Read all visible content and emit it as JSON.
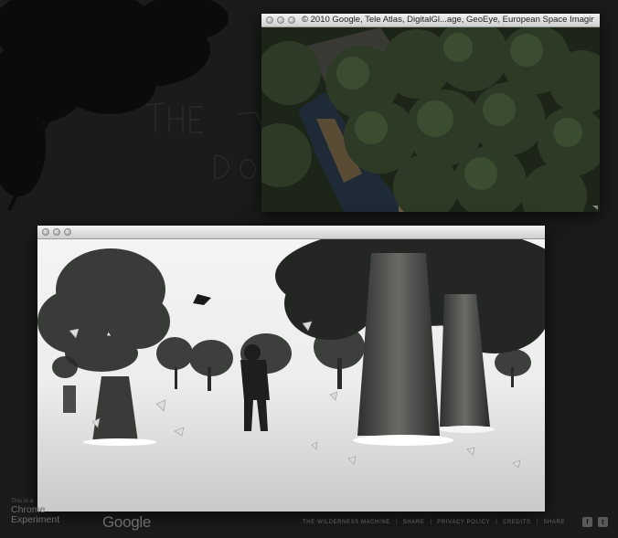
{
  "map_window": {
    "title": "© 2010 Google, Tele Atlas, DigitalGl...age, GeoEye, European Space Imaging"
  },
  "footer": {
    "badge_small": "This is a",
    "badge_line1": "Chrome",
    "badge_line2": "Experiment",
    "google": "Google",
    "links": [
      "The Wilderness Machine",
      "Share",
      "Privacy Policy",
      "Credits",
      "Share"
    ],
    "social": [
      "f",
      "t"
    ]
  }
}
